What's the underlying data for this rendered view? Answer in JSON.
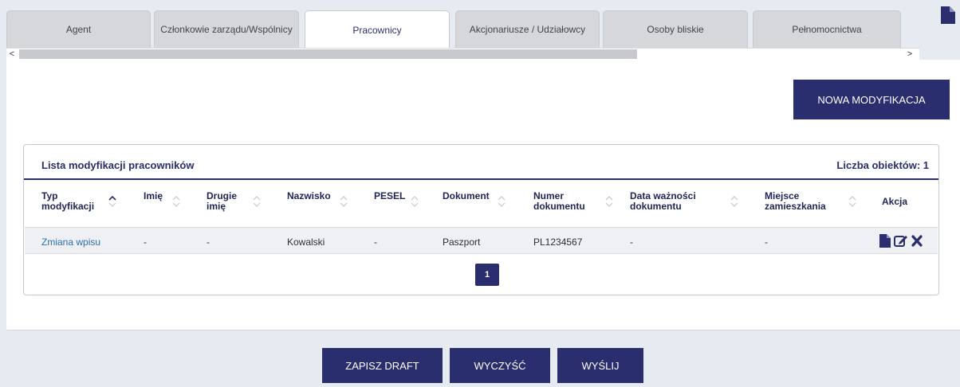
{
  "tabs": [
    {
      "label": "Agent"
    },
    {
      "label": "Członkowie zarządu/Wspólnicy"
    },
    {
      "label": "Pracownicy"
    },
    {
      "label": "Akcjonariusze / Udziałowcy"
    },
    {
      "label": "Osoby bliskie"
    },
    {
      "label": "Pełnomocnictwa"
    }
  ],
  "scrollbar": {
    "left_arrow": "<",
    "right_arrow": ">"
  },
  "new_modification_label": "NOWA MODYFIKACJA",
  "list": {
    "title": "Lista modyfikacji pracowników",
    "count_label": "Liczba obiektów: 1",
    "columns": [
      {
        "label": "Typ modyfikacji"
      },
      {
        "label": "Imię"
      },
      {
        "label": "Drugie imię"
      },
      {
        "label": "Nazwisko"
      },
      {
        "label": "PESEL"
      },
      {
        "label": "Dokument"
      },
      {
        "label": "Numer dokumentu"
      },
      {
        "label": "Data ważności dokumentu"
      },
      {
        "label": "Miejsce zamieszkania"
      },
      {
        "label": "Akcja"
      }
    ],
    "rows": [
      {
        "typ": "Zmiana wpisu",
        "imie": "-",
        "drugie_imie": "-",
        "nazwisko": "Kowalski",
        "pesel": "-",
        "dokument": "Paszport",
        "numer": "PL1234567",
        "data": "-",
        "miejsce": "-"
      }
    ],
    "page": "1"
  },
  "footer": {
    "draft_label": "ZAPISZ DRAFT",
    "clear_label": "WYCZYŚĆ",
    "send_label": "WYŚLIJ"
  },
  "icons": {
    "top_right": "document-icon",
    "actions": [
      "document-icon",
      "edit-icon",
      "delete-icon"
    ]
  },
  "colors": {
    "accent": "#2a2d6e",
    "link": "#2c6fb0",
    "background": "#e6ebf2"
  }
}
